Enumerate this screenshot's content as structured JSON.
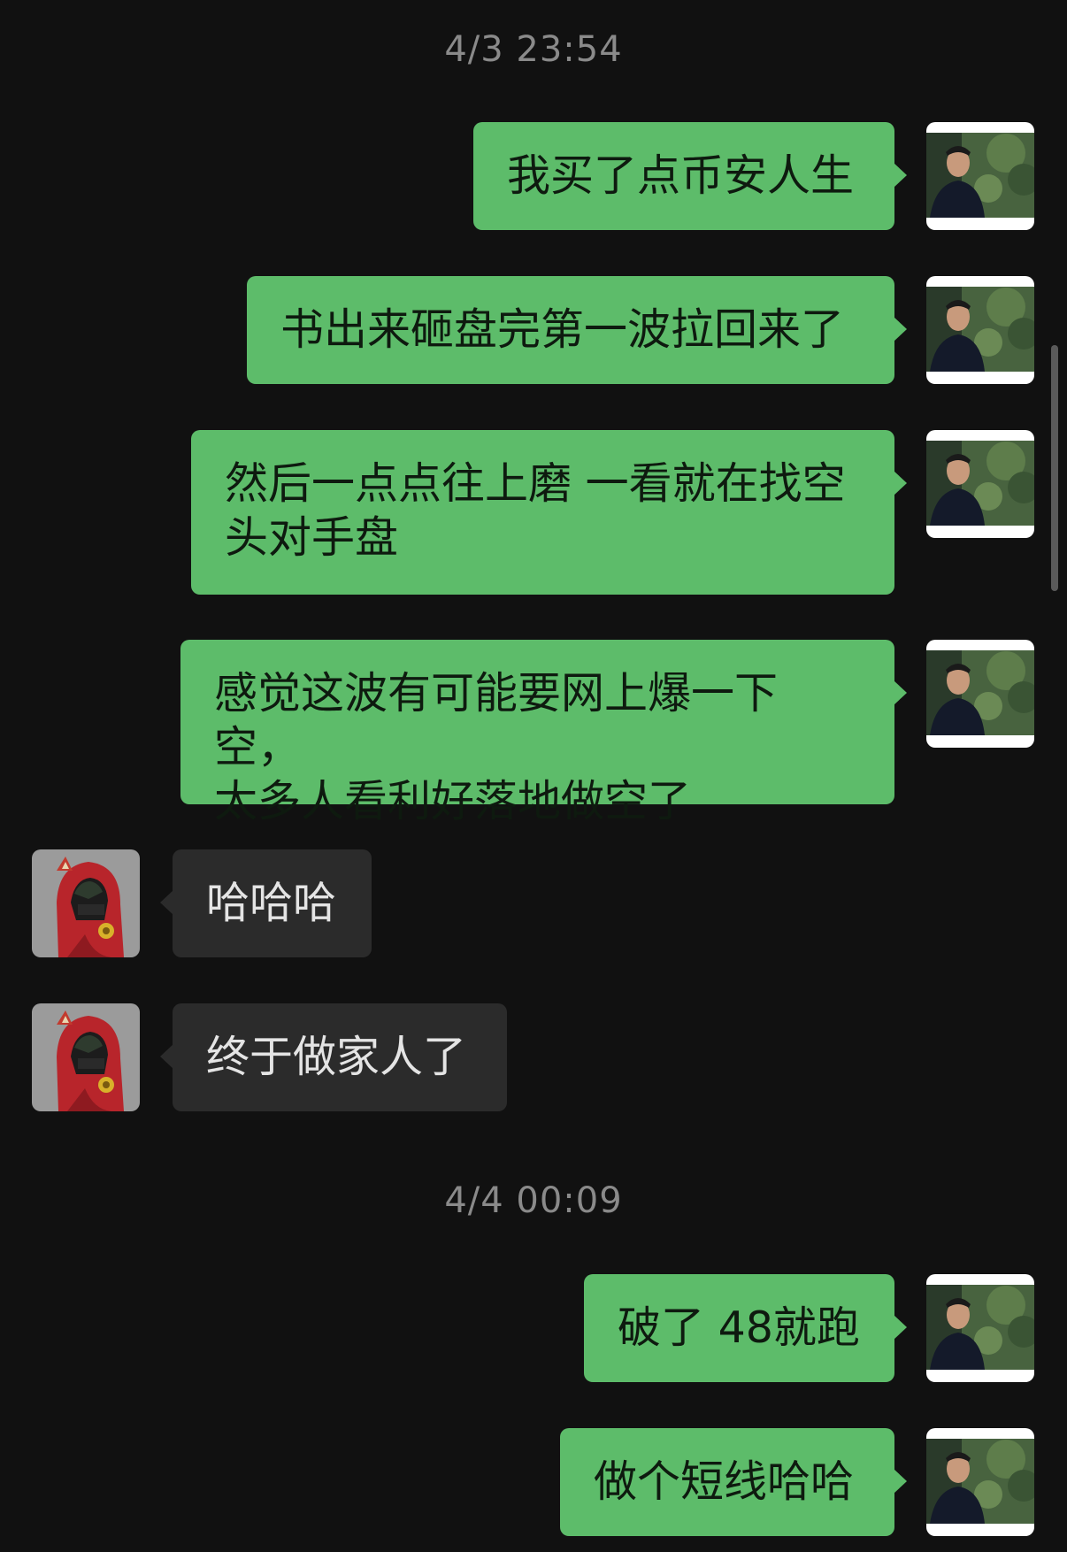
{
  "timestamps": {
    "first": "4/3 23:54",
    "second": "4/4 00:09"
  },
  "messages": [
    {
      "sender": "me",
      "text": "我买了点币安人生"
    },
    {
      "sender": "me",
      "text": "书出来砸盘完第一波拉回来了"
    },
    {
      "sender": "me",
      "text": "然后一点点往上磨 一看就在找空\n头对手盘"
    },
    {
      "sender": "me",
      "text": "感觉这波有可能要网上爆一下空，\n太多人看利好落地做空了"
    },
    {
      "sender": "them",
      "text": "哈哈哈"
    },
    {
      "sender": "them",
      "text": "终于做家人了"
    },
    {
      "sender": "me",
      "text": "破了 48就跑"
    },
    {
      "sender": "me",
      "text": "做个短线哈哈"
    }
  ],
  "avatars": {
    "me": "profile-photo-man-with-trees",
    "them": "red-hooded-character-avatar"
  },
  "colors": {
    "background": "#111111",
    "my_bubble": "#5dbc6a",
    "their_bubble": "#2b2b2b",
    "timestamp": "#8a8a8a"
  }
}
